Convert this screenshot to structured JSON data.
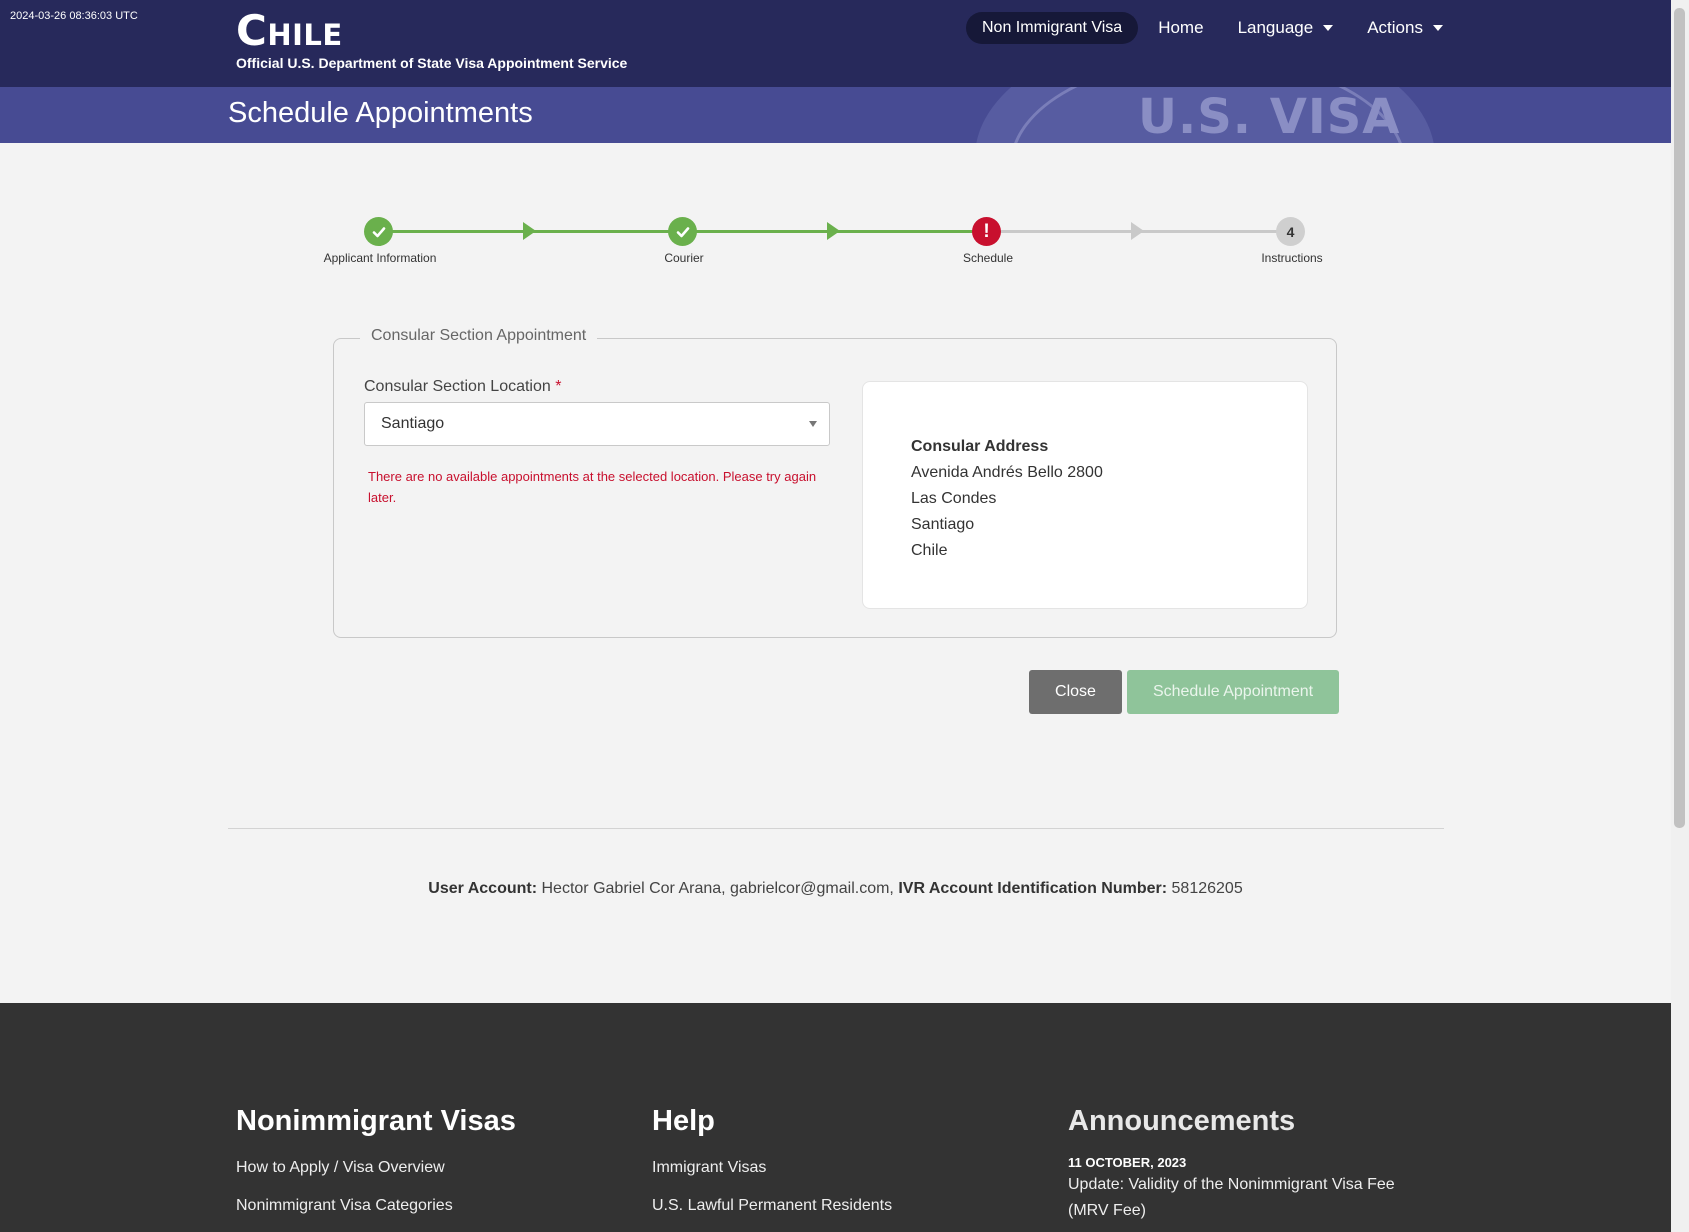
{
  "header": {
    "timestamp": "2024-03-26 08:36:03 UTC",
    "title": "Chile",
    "subtitle": "Official U.S. Department of State Visa Appointment Service",
    "seal_text": "U.S. VISA",
    "nav": {
      "pill": "Non Immigrant Visa",
      "home": "Home",
      "language": "Language",
      "actions": "Actions"
    }
  },
  "page": {
    "title": "Schedule Appointments"
  },
  "steps": [
    {
      "label": "Applicant Information",
      "state": "complete"
    },
    {
      "label": "Courier",
      "state": "complete"
    },
    {
      "label": "Schedule",
      "state": "error"
    },
    {
      "label": "Instructions",
      "state": "pending",
      "number": "4"
    }
  ],
  "form": {
    "legend": "Consular Section Appointment",
    "location_label": "Consular Section Location",
    "required_mark": "*",
    "location_value": "Santiago",
    "error": "There are no available appointments at the selected location. Please try again later."
  },
  "address": {
    "title": "Consular Address",
    "line1": "Avenida Andrés Bello 2800",
    "line2": "Las Condes",
    "line3": "Santiago",
    "line4": "Chile"
  },
  "buttons": {
    "close": "Close",
    "schedule": "Schedule Appointment"
  },
  "account": {
    "user_label": "User Account:",
    "user_value": "Hector Gabriel Cor Arana, gabrielcor@gmail.com,",
    "ivr_label": "IVR Account Identification Number:",
    "ivr_value": "58126205"
  },
  "footer": {
    "col1": {
      "title": "Nonimmigrant Visas",
      "links": [
        "How to Apply / Visa Overview",
        "Nonimmigrant Visa Categories"
      ]
    },
    "col2": {
      "title": "Help",
      "links": [
        "Immigrant Visas",
        "U.S. Lawful Permanent Residents"
      ]
    },
    "col3": {
      "title": "Announcements",
      "date": "11 OCTOBER, 2023",
      "news": "Update: Validity of the Nonimmigrant Visa Fee (MRV Fee)"
    }
  },
  "colors": {
    "header_bg": "#27295b",
    "subheader_bg": "#474b93",
    "step_complete": "#6ab04c",
    "step_error": "#c8102e",
    "step_pending": "#cfcfcf",
    "footer_bg": "#333333"
  }
}
